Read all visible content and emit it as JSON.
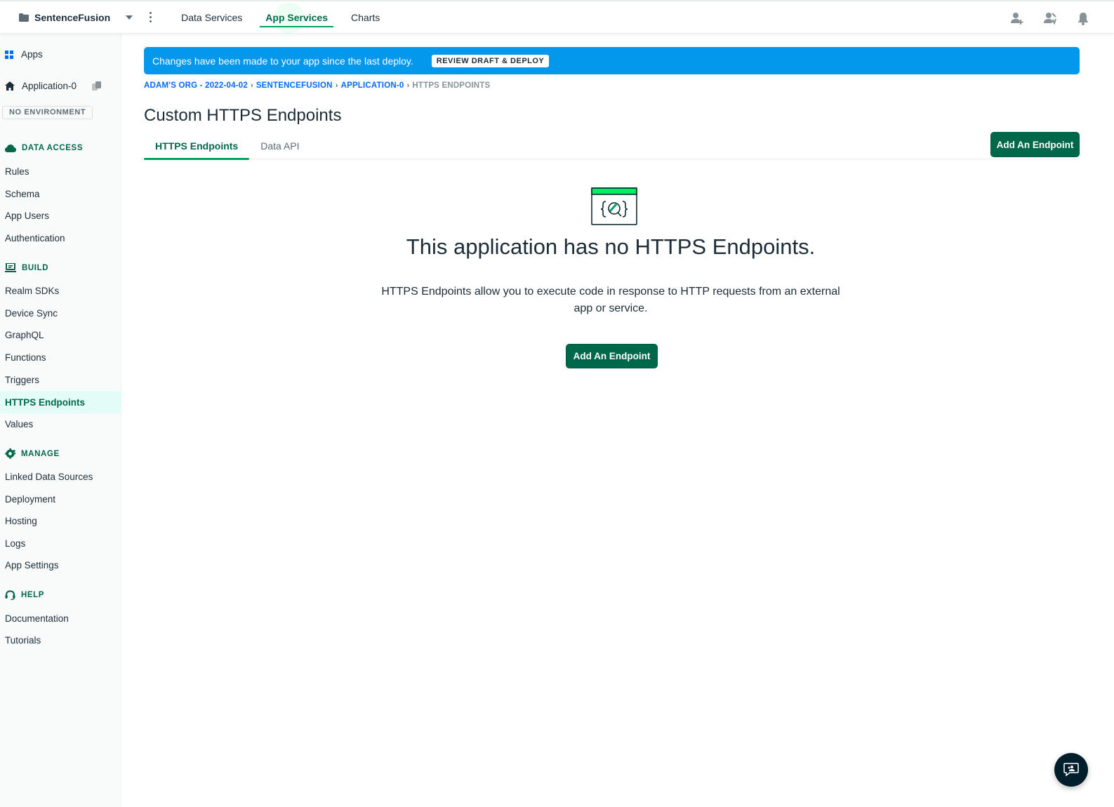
{
  "topbar": {
    "project_name": "SentenceFusion",
    "nav": [
      "Data Services",
      "App Services",
      "Charts"
    ],
    "active_nav": "App Services",
    "icons": [
      "invite-user-icon",
      "user-activity-icon",
      "bell-icon"
    ]
  },
  "sidebar": {
    "apps_label": "Apps",
    "app_name": "Application-0",
    "environment": "NO ENVIRONMENT",
    "sections": [
      {
        "heading": "DATA ACCESS",
        "icon": "cloud-icon",
        "items": [
          "Rules",
          "Schema",
          "App Users",
          "Authentication"
        ]
      },
      {
        "heading": "BUILD",
        "icon": "laptop-icon",
        "items": [
          "Realm SDKs",
          "Device Sync",
          "GraphQL",
          "Functions",
          "Triggers",
          "HTTPS Endpoints",
          "Values"
        ]
      },
      {
        "heading": "MANAGE",
        "icon": "gear-icon",
        "items": [
          "Linked Data Sources",
          "Deployment",
          "Hosting",
          "Logs",
          "App Settings"
        ]
      },
      {
        "heading": "HELP",
        "icon": "support-icon",
        "items": [
          "Documentation",
          "Tutorials"
        ]
      }
    ],
    "active_item": "HTTPS Endpoints"
  },
  "banner": {
    "text": "Changes have been made to your app since the last deploy.",
    "button": "REVIEW DRAFT & DEPLOY"
  },
  "breadcrumb": [
    "ADAM'S ORG - 2022-04-02",
    "SENTENCEFUSION",
    "APPLICATION-0",
    "HTTPS ENDPOINTS"
  ],
  "page": {
    "title": "Custom HTTPS Endpoints",
    "tabs": [
      "HTTPS Endpoints",
      "Data API"
    ],
    "active_tab": "HTTPS Endpoints",
    "add_button": "Add An Endpoint"
  },
  "empty_state": {
    "title": "This application has no HTTPS Endpoints.",
    "description": "HTTPS Endpoints allow you to execute code in response to HTTP requests from an external app or service.",
    "button": "Add An Endpoint"
  },
  "colors": {
    "brand_green": "#00684a",
    "accent_green": "#00ed64",
    "banner_blue": "#0498ec",
    "link_blue": "#016bf8"
  }
}
